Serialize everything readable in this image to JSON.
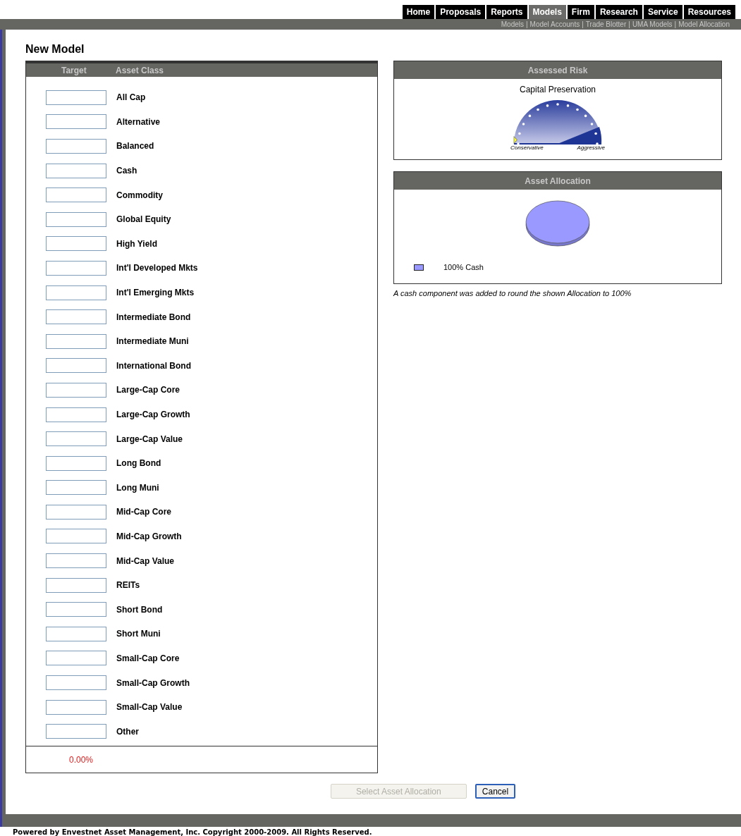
{
  "nav_tabs": [
    {
      "label": "Home",
      "selected": false
    },
    {
      "label": "Proposals",
      "selected": false
    },
    {
      "label": "Reports",
      "selected": false
    },
    {
      "label": "Models",
      "selected": true
    },
    {
      "label": "Firm",
      "selected": false
    },
    {
      "label": "Research",
      "selected": false
    },
    {
      "label": "Service",
      "selected": false
    },
    {
      "label": "Resources",
      "selected": false
    }
  ],
  "sub_links": [
    "Models",
    "Model Accounts",
    "Trade Blotter",
    "UMA Models",
    "Model Allocation"
  ],
  "sub_link_separator": "|",
  "page_title": "New Model",
  "targets_table": {
    "columns": [
      "Target",
      "Asset Class"
    ],
    "rows": [
      "All Cap",
      "Alternative",
      "Balanced",
      "Cash",
      "Commodity",
      "Global Equity",
      "High Yield",
      "Int'l Developed Mkts",
      "Int'l Emerging Mkts",
      "Intermediate Bond",
      "Intermediate Muni",
      "International Bond",
      "Large-Cap Core",
      "Large-Cap Growth",
      "Large-Cap Value",
      "Long Bond",
      "Long Muni",
      "Mid-Cap Core",
      "Mid-Cap Growth",
      "Mid-Cap Value",
      "REITs",
      "Short Bond",
      "Short Muni",
      "Small-Cap Core",
      "Small-Cap Growth",
      "Small-Cap Value",
      "Other"
    ],
    "total": "0.00%"
  },
  "assessed_risk": {
    "title": "Assessed Risk",
    "profile": "Capital Preservation",
    "gauge": {
      "min_label": "Conservative",
      "max_label": "Aggressive"
    }
  },
  "asset_allocation": {
    "title": "Asset Allocation",
    "legend": [
      {
        "label": "100% Cash",
        "color": "#9999ff"
      }
    ],
    "note": "A cash component was added to round the shown Allocation to 100%"
  },
  "buttons": [
    {
      "label": "Select Asset Allocation",
      "disabled": true
    },
    {
      "label": "Cancel",
      "disabled": false
    }
  ],
  "footer": "Powered by Envestnet Asset Management, Inc. Copyright 2000-2009. All Rights Reserved."
}
